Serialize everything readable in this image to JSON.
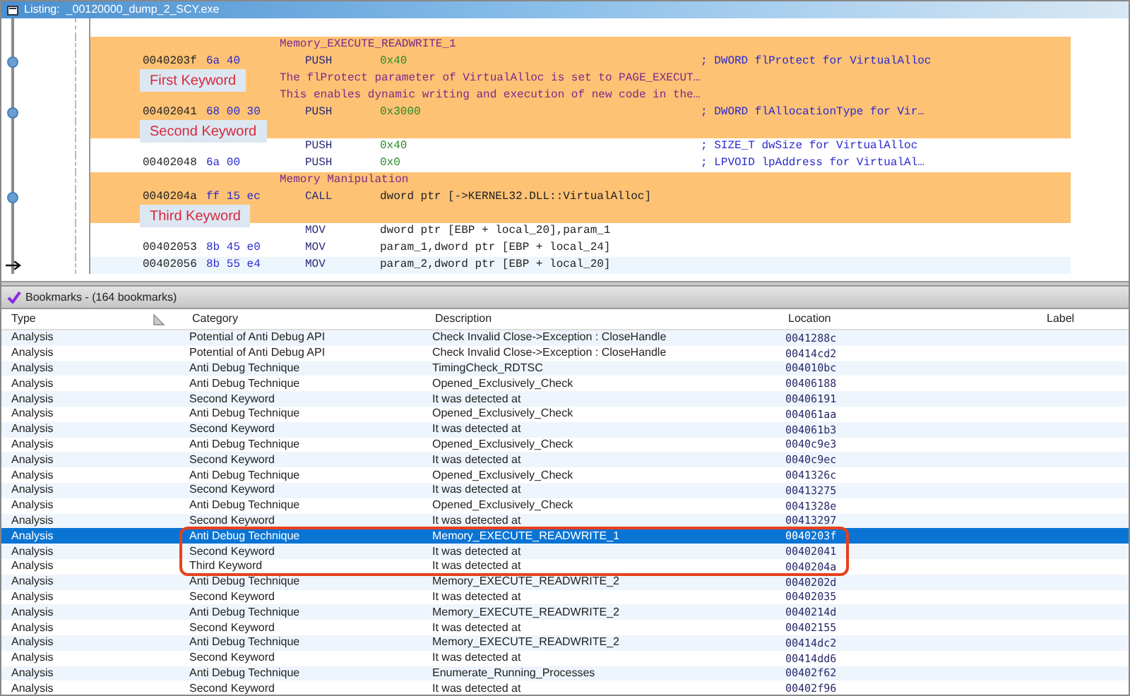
{
  "window": {
    "title": "Listing:  _00120000_dump_2_SCY.exe"
  },
  "listing": {
    "lines": [
      {
        "kind": "plate",
        "highlighted": true,
        "text": "Memory_EXECUTE_READWRITE_1"
      },
      {
        "kind": "code",
        "highlighted": true,
        "bookmark": true,
        "cursor": false,
        "address": "0040203f",
        "bytes": "6a 40",
        "mnemonic": "PUSH",
        "operand": "0x40",
        "scalar": true,
        "comment": "; DWORD flProtect for VirtualAlloc"
      },
      {
        "kind": "comment",
        "highlighted": true,
        "text": "The flProtect parameter of VirtualAlloc is set to PAGE_EXECUT…",
        "callout": "First Keyword"
      },
      {
        "kind": "comment",
        "highlighted": true,
        "text": "This enables dynamic writing and execution of new code in the…"
      },
      {
        "kind": "code",
        "highlighted": true,
        "bookmark": true,
        "cursor": false,
        "address": "00402041",
        "bytes": "68 00 30",
        "mnemonic": "PUSH",
        "operand": "0x3000",
        "scalar": true,
        "comment": "; DWORD flAllocationType for Vir…"
      },
      {
        "kind": "blank",
        "highlighted": true,
        "callout": "Second Keyword"
      },
      {
        "kind": "code",
        "highlighted": false,
        "cursor": false,
        "mnemonic": "PUSH",
        "operand": "0x40",
        "scalar": true,
        "comment": "; SIZE_T dwSize for VirtualAlloc"
      },
      {
        "kind": "code",
        "highlighted": false,
        "cursor": false,
        "address": "00402048",
        "bytes": "6a 00",
        "mnemonic": "PUSH",
        "operand": "0x0",
        "scalar": true,
        "comment": "; LPVOID lpAddress for VirtualAl…"
      },
      {
        "kind": "plate",
        "highlighted": true,
        "text": "Memory Manipulation"
      },
      {
        "kind": "code",
        "highlighted": true,
        "bookmark": true,
        "cursor": false,
        "address": "0040204a",
        "bytes": "ff 15 ec",
        "mnemonic": "CALL",
        "operand": "dword ptr [->KERNEL32.DLL::VirtualAlloc]",
        "scalar": false
      },
      {
        "kind": "blank",
        "highlighted": true,
        "callout": "Third Keyword"
      },
      {
        "kind": "code",
        "highlighted": false,
        "cursor": false,
        "mnemonic": "MOV",
        "operand": "dword ptr [EBP + local_20],param_1",
        "scalar": false
      },
      {
        "kind": "code",
        "highlighted": false,
        "cursor": false,
        "address": "00402053",
        "bytes": "8b 45 e0",
        "mnemonic": "MOV",
        "operand": "param_1,dword ptr [EBP + local_24]",
        "scalar": false
      },
      {
        "kind": "code",
        "highlighted": false,
        "cursor": true,
        "address": "00402056",
        "bytes": "8b 55 e4",
        "mnemonic": "MOV",
        "operand": "param_2,dword ptr [EBP + local_20]",
        "scalar": false
      }
    ]
  },
  "bookmarks": {
    "title": "Bookmarks - (164 bookmarks)",
    "columns": [
      "Type",
      "Category",
      "Description",
      "Location",
      "Label"
    ],
    "rows": [
      {
        "type": "Analysis",
        "category": "Potential of Anti Debug API",
        "description": "Check Invalid Close->Exception : CloseHandle",
        "location": "0041288c",
        "selected": false,
        "outlined": false
      },
      {
        "type": "Analysis",
        "category": "Potential of Anti Debug API",
        "description": "Check Invalid Close->Exception : CloseHandle",
        "location": "00414cd2",
        "selected": false,
        "outlined": false
      },
      {
        "type": "Analysis",
        "category": "Anti Debug Technique",
        "description": "TimingCheck_RDTSC",
        "location": "004010bc",
        "selected": false,
        "outlined": false
      },
      {
        "type": "Analysis",
        "category": "Anti Debug Technique",
        "description": "Opened_Exclusively_Check",
        "location": "00406188",
        "selected": false,
        "outlined": false
      },
      {
        "type": "Analysis",
        "category": "Second Keyword",
        "description": "It was detected at",
        "location": "00406191",
        "selected": false,
        "outlined": false
      },
      {
        "type": "Analysis",
        "category": "Anti Debug Technique",
        "description": "Opened_Exclusively_Check",
        "location": "004061aa",
        "selected": false,
        "outlined": false
      },
      {
        "type": "Analysis",
        "category": "Second Keyword",
        "description": "It was detected at",
        "location": "004061b3",
        "selected": false,
        "outlined": false
      },
      {
        "type": "Analysis",
        "category": "Anti Debug Technique",
        "description": "Opened_Exclusively_Check",
        "location": "0040c9e3",
        "selected": false,
        "outlined": false
      },
      {
        "type": "Analysis",
        "category": "Second Keyword",
        "description": "It was detected at",
        "location": "0040c9ec",
        "selected": false,
        "outlined": false
      },
      {
        "type": "Analysis",
        "category": "Anti Debug Technique",
        "description": "Opened_Exclusively_Check",
        "location": "0041326c",
        "selected": false,
        "outlined": false
      },
      {
        "type": "Analysis",
        "category": "Second Keyword",
        "description": "It was detected at",
        "location": "00413275",
        "selected": false,
        "outlined": false
      },
      {
        "type": "Analysis",
        "category": "Anti Debug Technique",
        "description": "Opened_Exclusively_Check",
        "location": "0041328e",
        "selected": false,
        "outlined": false
      },
      {
        "type": "Analysis",
        "category": "Second Keyword",
        "description": "It was detected at",
        "location": "00413297",
        "selected": false,
        "outlined": false
      },
      {
        "type": "Analysis",
        "category": "Anti Debug Technique",
        "description": "Memory_EXECUTE_READWRITE_1",
        "location": "0040203f",
        "selected": true,
        "outlined": true
      },
      {
        "type": "Analysis",
        "category": "Second Keyword",
        "description": "It was detected at",
        "location": "00402041",
        "selected": false,
        "outlined": true
      },
      {
        "type": "Analysis",
        "category": "Third Keyword",
        "description": "It was detected at",
        "location": "0040204a",
        "selected": false,
        "outlined": true
      },
      {
        "type": "Analysis",
        "category": "Anti Debug Technique",
        "description": "Memory_EXECUTE_READWRITE_2",
        "location": "0040202d",
        "selected": false,
        "outlined": false
      },
      {
        "type": "Analysis",
        "category": "Second Keyword",
        "description": "It was detected at",
        "location": "00402035",
        "selected": false,
        "outlined": false
      },
      {
        "type": "Analysis",
        "category": "Anti Debug Technique",
        "description": "Memory_EXECUTE_READWRITE_2",
        "location": "0040214d",
        "selected": false,
        "outlined": false
      },
      {
        "type": "Analysis",
        "category": "Second Keyword",
        "description": "It was detected at",
        "location": "00402155",
        "selected": false,
        "outlined": false
      },
      {
        "type": "Analysis",
        "category": "Anti Debug Technique",
        "description": "Memory_EXECUTE_READWRITE_2",
        "location": "00414dc2",
        "selected": false,
        "outlined": false
      },
      {
        "type": "Analysis",
        "category": "Second Keyword",
        "description": "It was detected at",
        "location": "00414dd6",
        "selected": false,
        "outlined": false
      },
      {
        "type": "Analysis",
        "category": "Anti Debug Technique",
        "description": "Enumerate_Running_Processes",
        "location": "00402f62",
        "selected": false,
        "outlined": false
      },
      {
        "type": "Analysis",
        "category": "Second Keyword",
        "description": "It was detected at",
        "location": "00402f96",
        "selected": false,
        "outlined": false
      }
    ]
  }
}
